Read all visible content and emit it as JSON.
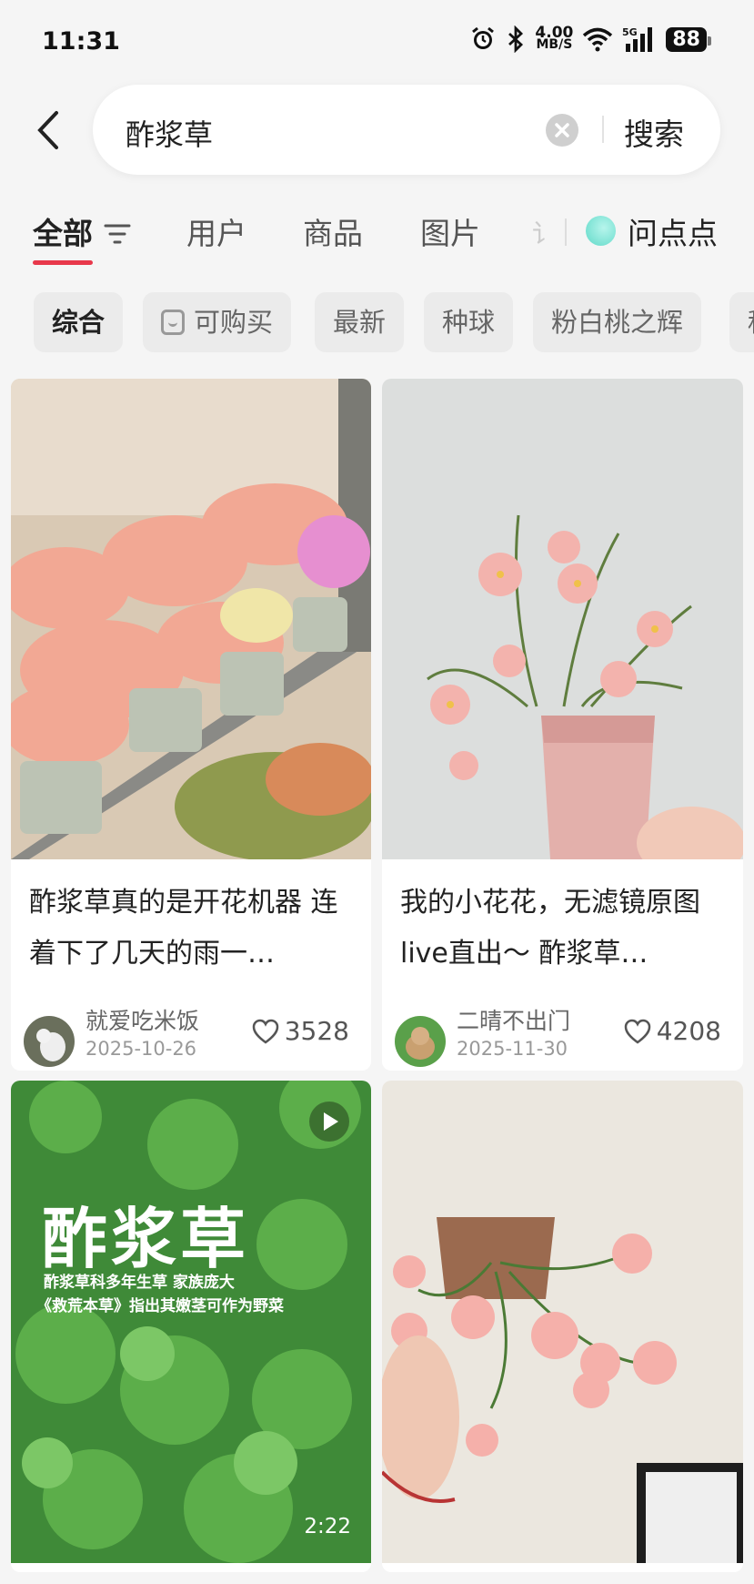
{
  "status_bar": {
    "time": "11:31",
    "net_speed": "4.00",
    "net_unit": "MB/S",
    "battery": "88"
  },
  "search": {
    "query": "酢浆草",
    "submit_label": "搜索"
  },
  "tabs": {
    "items": [
      "全部",
      "用户",
      "商品",
      "图片"
    ],
    "fade_fragment": "讠",
    "ask_label": "问点点"
  },
  "chips": {
    "items": [
      "综合",
      "可购买",
      "最新",
      "种球",
      "粉白桃之辉",
      "种"
    ]
  },
  "cards": [
    {
      "title": "酢浆草真的是开花机器 连着下了几天的雨一…",
      "author": "就爱吃米饭",
      "date": "2025-10-26",
      "likes": "3528"
    },
    {
      "title": "我的小花花，无滤镜原图live直出～ 酢浆草…",
      "author": "二晴不出门",
      "date": "2025-11-30",
      "likes": "4208"
    },
    {
      "overlay_title": "酢浆草",
      "overlay_line1": "酢浆草科多年生草 家族庞大",
      "overlay_line2": "《救荒本草》指出其嫩茎可作为野菜",
      "duration": "2:22"
    },
    {}
  ],
  "colors": {
    "accent": "#e8384b",
    "background": "#f5f5f5"
  }
}
